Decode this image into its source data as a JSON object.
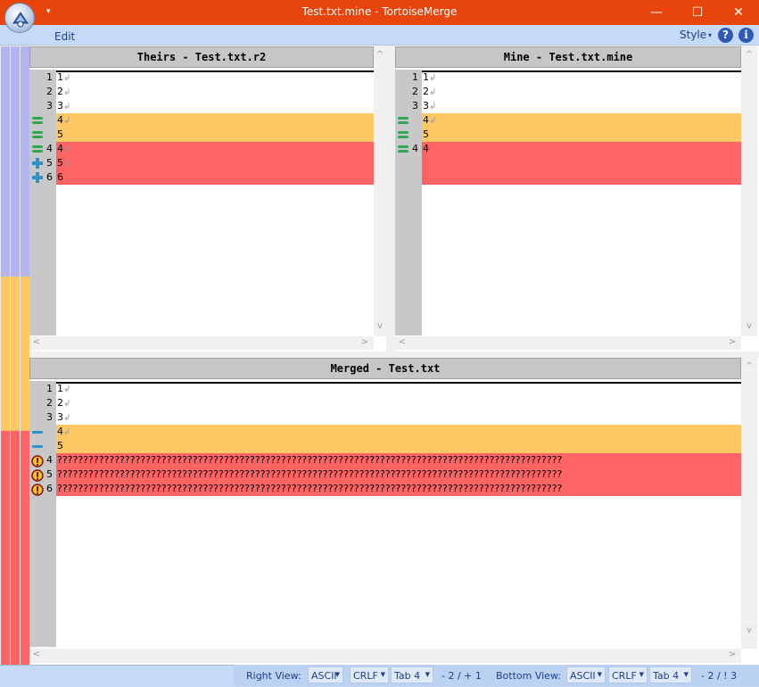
{
  "window": {
    "title": "Test.txt.mine - TortoiseMerge",
    "minimize": "—",
    "maximize": "☐",
    "close": "✕",
    "qat_arrow": "▾"
  },
  "ribbon": {
    "edit_menu": "Edit",
    "style_menu": "Style",
    "style_arrow": "▾",
    "help": "?",
    "info": "i"
  },
  "colors": {
    "accent": "#e8450c",
    "conflict": "#ff6464",
    "changed": "#ffc864",
    "gutter": "#c8c8c8",
    "locator_blue": "#b4b4f0"
  },
  "theirs": {
    "header": "Theirs - Test.txt.r2",
    "lines": [
      {
        "num": "1",
        "text": "1",
        "eol": "↲",
        "type": "normal",
        "icon": ""
      },
      {
        "num": "2",
        "text": "2",
        "eol": "↲",
        "type": "normal",
        "icon": ""
      },
      {
        "num": "3",
        "text": "3",
        "eol": "↲",
        "type": "normal",
        "icon": ""
      },
      {
        "num": "",
        "text": "4",
        "eol": "↲",
        "type": "changed",
        "icon": "equal-icon"
      },
      {
        "num": "",
        "text": "5",
        "eol": "",
        "type": "changed",
        "icon": "equal-icon"
      },
      {
        "num": "4",
        "text": "4",
        "eol": "↲",
        "type": "conflict",
        "icon": "equal-icon"
      },
      {
        "num": "5",
        "text": "5",
        "eol": "↲",
        "type": "conflict",
        "icon": "plus-icon"
      },
      {
        "num": "6",
        "text": "6",
        "eol": "",
        "type": "conflict",
        "icon": "plus-icon"
      }
    ]
  },
  "mine": {
    "header": "Mine - Test.txt.mine",
    "lines": [
      {
        "num": "1",
        "text": "1",
        "eol": "↲",
        "type": "normal",
        "icon": ""
      },
      {
        "num": "2",
        "text": "2",
        "eol": "↲",
        "type": "normal",
        "icon": ""
      },
      {
        "num": "3",
        "text": "3",
        "eol": "↲",
        "type": "normal",
        "icon": ""
      },
      {
        "num": "",
        "text": "4",
        "eol": "↲",
        "type": "changed",
        "icon": "equal-icon"
      },
      {
        "num": "",
        "text": "5",
        "eol": "",
        "type": "changed",
        "icon": "equal-icon"
      },
      {
        "num": "4",
        "text": "4",
        "eol": "",
        "type": "conflict",
        "icon": "equal-icon"
      },
      {
        "num": "",
        "text": "",
        "eol": "",
        "type": "conflict",
        "icon": ""
      },
      {
        "num": "",
        "text": "",
        "eol": "",
        "type": "conflict",
        "icon": ""
      }
    ]
  },
  "merged": {
    "header": "Merged - Test.txt",
    "lines": [
      {
        "num": "1",
        "text": "1",
        "eol": "↲",
        "type": "normal",
        "icon": ""
      },
      {
        "num": "2",
        "text": "2",
        "eol": "↲",
        "type": "normal",
        "icon": ""
      },
      {
        "num": "3",
        "text": "3",
        "eol": "↲",
        "type": "normal",
        "icon": ""
      },
      {
        "num": "",
        "text": "4",
        "eol": "↲",
        "type": "changed",
        "icon": "minus-icon"
      },
      {
        "num": "",
        "text": "5",
        "eol": "",
        "type": "changed",
        "icon": "minus-icon"
      },
      {
        "num": "4",
        "text": "?????????????????????????????????????????????????????????????????????????????????????????????????",
        "eol": "",
        "type": "conflict",
        "icon": "conflict-icon"
      },
      {
        "num": "5",
        "text": "?????????????????????????????????????????????????????????????????????????????????????????????????",
        "eol": "",
        "type": "conflict",
        "icon": "conflict-icon"
      },
      {
        "num": "6",
        "text": "?????????????????????????????????????????????????????????????????????????????????????????????????",
        "eol": "",
        "type": "conflict",
        "icon": "conflict-icon"
      }
    ]
  },
  "statusbar": {
    "right_view_label": "Right View:",
    "right_encoding": "ASCII",
    "right_eol": "CRLF",
    "right_tab": "Tab 4",
    "right_count": "- 2 / + 1",
    "bottom_view_label": "Bottom View:",
    "bottom_encoding": "ASCII",
    "bottom_eol": "CRLF",
    "bottom_tab": "Tab 4",
    "bottom_count": "- 2 / ! 3",
    "drop_arrow": "▼"
  },
  "scroll": {
    "up": "^",
    "down": "v",
    "left": "<",
    "right": ">"
  }
}
